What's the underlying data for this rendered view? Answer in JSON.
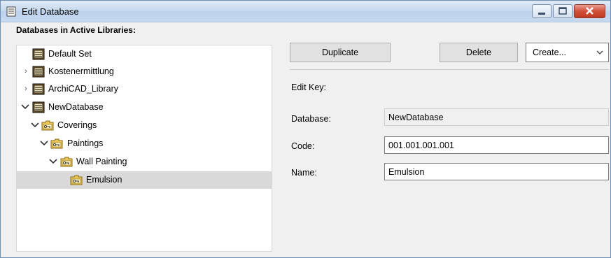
{
  "window": {
    "title": "Edit Database"
  },
  "tree": {
    "heading": "Databases in Active Libraries:",
    "items": [
      {
        "label": "Default Set",
        "icon": "database-icon",
        "expander": ""
      },
      {
        "label": "Kostenermittlung",
        "icon": "database-icon",
        "expander": "collapsed"
      },
      {
        "label": "ArchiCAD_Library",
        "icon": "database-icon",
        "expander": "collapsed"
      },
      {
        "label": "NewDatabase",
        "icon": "database-icon",
        "expander": "expanded"
      },
      {
        "label": "Coverings",
        "icon": "key-folder-icon",
        "expander": "expanded"
      },
      {
        "label": "Paintings",
        "icon": "key-folder-icon",
        "expander": "expanded"
      },
      {
        "label": "Wall Painting",
        "icon": "key-folder-icon",
        "expander": "expanded"
      },
      {
        "label": "Emulsion",
        "icon": "key-folder-icon",
        "expander": "",
        "selected": true
      }
    ]
  },
  "toolbar": {
    "duplicate_label": "Duplicate",
    "delete_label": "Delete",
    "create_value": "Create..."
  },
  "form": {
    "section_label": "Edit Key:",
    "database_label": "Database:",
    "database_value": "NewDatabase",
    "code_label": "Code:",
    "code_value": "001.001.001.001",
    "name_label": "Name:",
    "name_value": "Emulsion"
  },
  "colors": {
    "selection": "#d9d9d9",
    "folder": "#e8c75a",
    "database": "#8b6a3a"
  }
}
